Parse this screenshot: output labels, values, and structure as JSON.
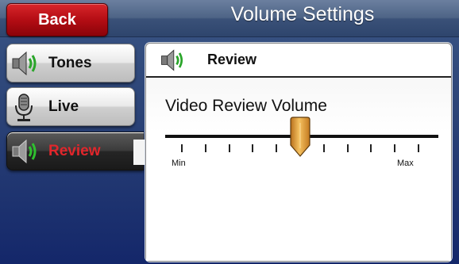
{
  "header": {
    "back_label": "Back",
    "title": "Volume Settings"
  },
  "sidebar": {
    "items": [
      {
        "label": "Tones",
        "icon": "speaker-icon",
        "active": false
      },
      {
        "label": "Live",
        "icon": "microphone-icon",
        "active": false
      },
      {
        "label": "Review",
        "icon": "speaker-icon",
        "active": true
      }
    ]
  },
  "panel": {
    "title": "Review",
    "slider": {
      "label": "Video Review Volume",
      "min_label": "Min",
      "max_label": "Max",
      "steps": 11,
      "value_step": 5
    }
  },
  "colors": {
    "accent_red": "#e1262b",
    "back_red": "#c0141a",
    "thumb_orange": "#e9a33a"
  }
}
